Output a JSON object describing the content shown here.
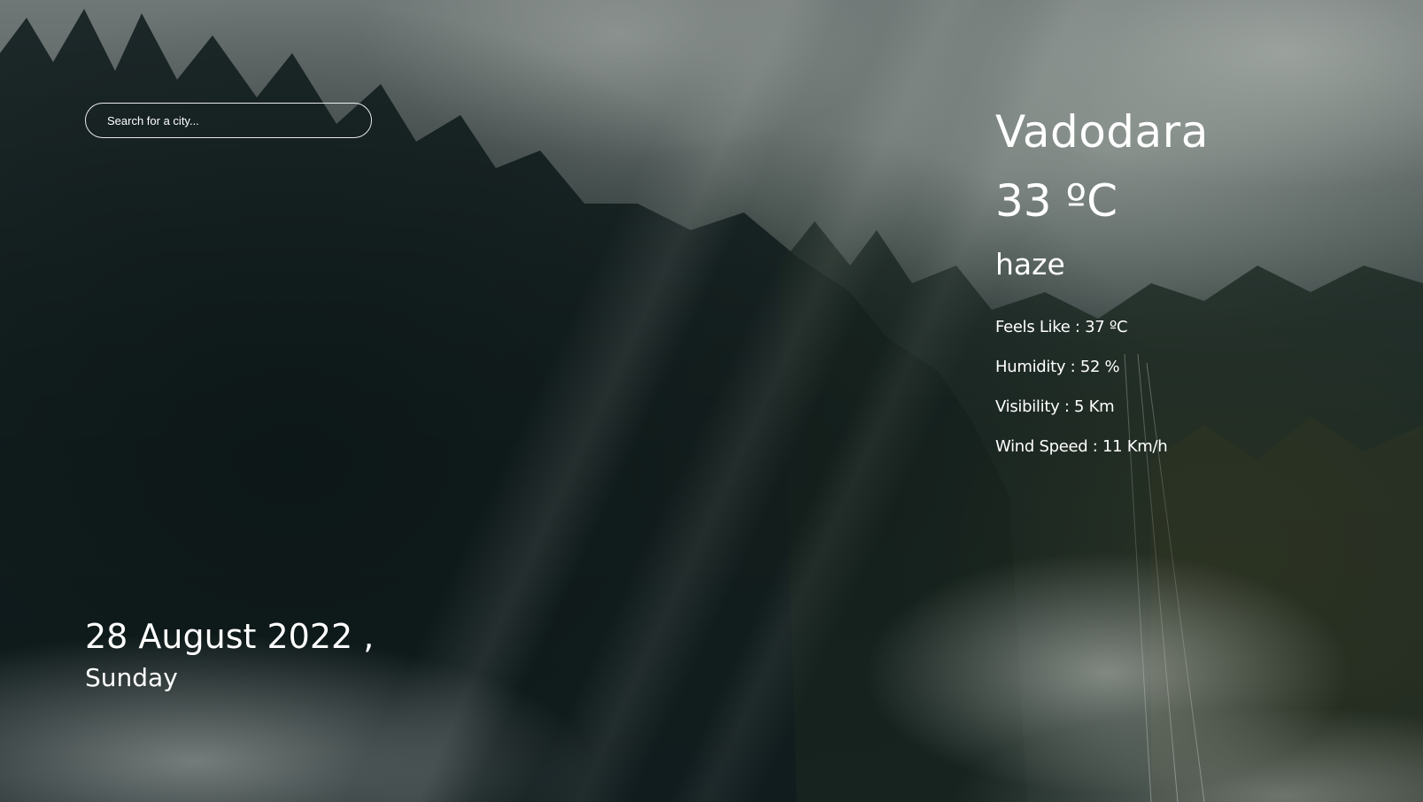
{
  "search": {
    "placeholder": "Search for a city..."
  },
  "weather": {
    "city": "Vadodara",
    "temperature": "33 ºC",
    "condition": "haze",
    "details": [
      {
        "label": "Feels Like : 37 ºC"
      },
      {
        "label": "Humidity : 52 %"
      },
      {
        "label": "Visibility : 5 Km"
      },
      {
        "label": "Wind Speed : 11 Km/h"
      }
    ]
  },
  "date": {
    "full": "28 August 2022 ,",
    "weekday": "Sunday"
  },
  "colors": {
    "text": "#ffffff",
    "overlay": "#1d2a2e"
  }
}
